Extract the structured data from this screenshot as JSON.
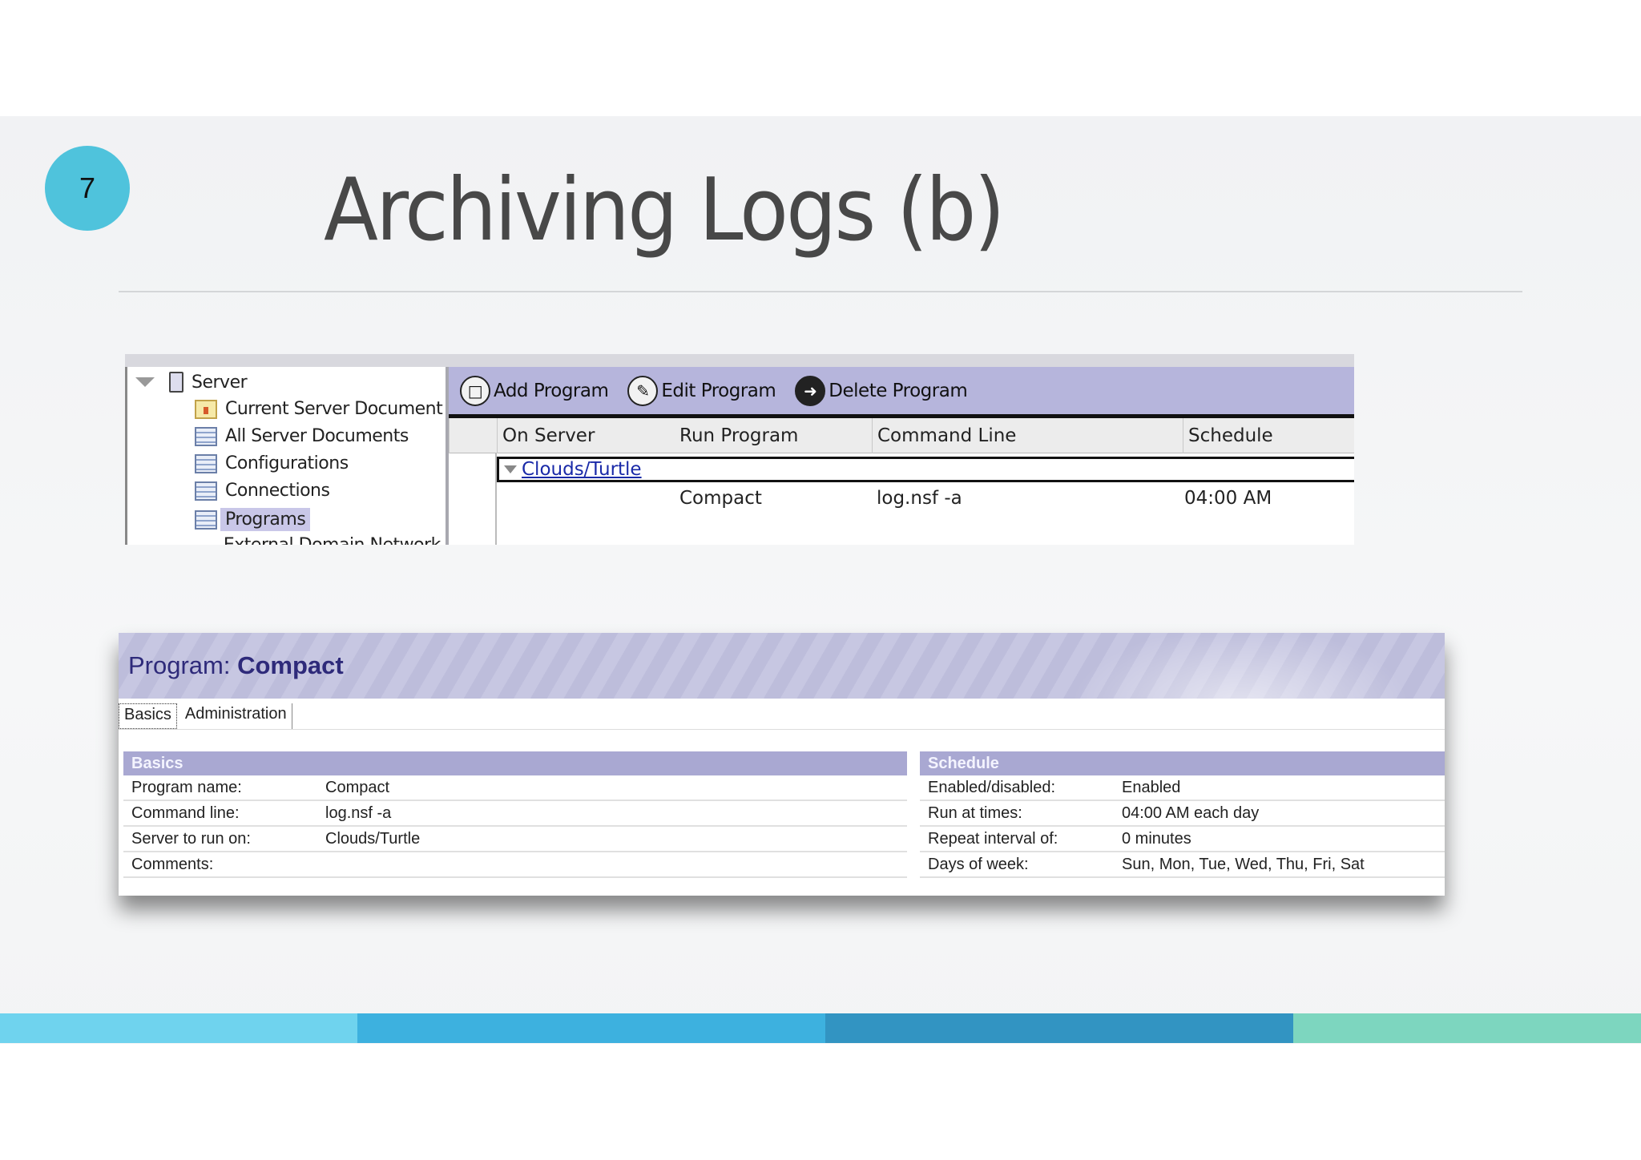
{
  "slide": {
    "number": "7",
    "title": "Archiving Logs (b)"
  },
  "nav": {
    "root": "Server",
    "items": [
      {
        "label": "Current Server Document",
        "icon": "document-icon"
      },
      {
        "label": "All Server Documents",
        "icon": "view-icon"
      },
      {
        "label": "Configurations",
        "icon": "view-icon"
      },
      {
        "label": "Connections",
        "icon": "view-icon"
      },
      {
        "label": "Programs",
        "icon": "view-icon",
        "selected": true
      },
      {
        "label": "External Domain Network Inf",
        "icon": "view-icon"
      }
    ]
  },
  "toolbar": {
    "add_program": "Add Program",
    "edit_program": "Edit Program",
    "delete_program": "Delete Program"
  },
  "view": {
    "columns": [
      "On Server",
      "Run Program",
      "Command Line",
      "Schedule"
    ],
    "category": "Clouds/Turtle",
    "rows": [
      {
        "run_program": "Compact",
        "command_line": "log.nsf -a",
        "schedule": "04:00 AM"
      }
    ]
  },
  "program_doc": {
    "title_prefix": "Program: ",
    "title_name": "Compact",
    "tabs": [
      "Basics",
      "Administration"
    ],
    "basics": {
      "heading": "Basics",
      "fields": [
        {
          "label": "Program name:",
          "value": "Compact"
        },
        {
          "label": "Command line:",
          "value": "log.nsf -a"
        },
        {
          "label": "Server to run on:",
          "value": "Clouds/Turtle"
        },
        {
          "label": "Comments:",
          "value": ""
        }
      ]
    },
    "schedule": {
      "heading": "Schedule",
      "fields": [
        {
          "label": "Enabled/disabled:",
          "value": "Enabled"
        },
        {
          "label": "Run at times:",
          "value": "04:00 AM each day"
        },
        {
          "label": "Repeat interval of:",
          "value": "0 minutes"
        },
        {
          "label": "Days of week:",
          "value": "Sun, Mon, Tue, Wed, Thu, Fri, Sat"
        }
      ]
    }
  },
  "colors": {
    "accent_circle": "#4fc3dc",
    "stripe": [
      "#6fd3ee",
      "#3db1df",
      "#3294c2",
      "#7dd6bf"
    ],
    "action_bar": "#b6b5dc",
    "section_head": "#a9a8d2"
  }
}
